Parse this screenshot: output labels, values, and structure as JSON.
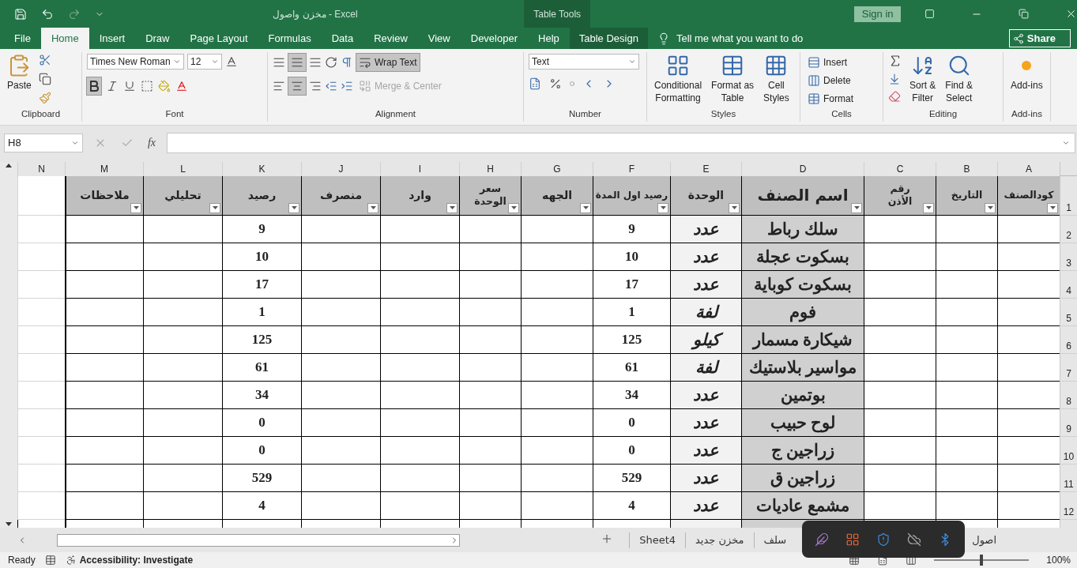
{
  "title_bar": {
    "title": "مخزن واصول  -  Excel",
    "context_group": "Table Tools",
    "sign_in": "Sign in"
  },
  "menu_tabs": {
    "file": {
      "label": "File",
      "selected": false,
      "kind": "file"
    },
    "home": {
      "label": "Home",
      "selected": true,
      "kind": "tab"
    },
    "insert": {
      "label": "Insert",
      "selected": false,
      "kind": "tab"
    },
    "draw": {
      "label": "Draw",
      "selected": false,
      "kind": "tab"
    },
    "page_layout": {
      "label": "Page Layout",
      "selected": false,
      "kind": "tab"
    },
    "formulas": {
      "label": "Formulas",
      "selected": false,
      "kind": "tab"
    },
    "data": {
      "label": "Data",
      "selected": false,
      "kind": "tab"
    },
    "review": {
      "label": "Review",
      "selected": false,
      "kind": "tab"
    },
    "view": {
      "label": "View",
      "selected": false,
      "kind": "tab"
    },
    "developer": {
      "label": "Developer",
      "selected": false,
      "kind": "tab"
    },
    "help": {
      "label": "Help",
      "selected": false,
      "kind": "tab"
    },
    "table_design": {
      "label": "Table Design",
      "selected": false,
      "kind": "context"
    }
  },
  "tell_me": {
    "placeholder": "Tell me what you want to do"
  },
  "share": "Share",
  "ribbon": {
    "clipboard": {
      "paste": "Paste",
      "label": "Clipboard"
    },
    "font": {
      "font_name": "Times New Roman",
      "font_size": "12",
      "bold_on": true,
      "label": "Font"
    },
    "alignment": {
      "middle_on": true,
      "center_on": true,
      "wrap_text": "Wrap Text",
      "wrap_on": true,
      "merge": "Merge & Center",
      "merge_disabled": true,
      "label": "Alignment"
    },
    "number": {
      "format": "Text",
      "label": "Number"
    },
    "styles": {
      "conditional_formatting": "Conditional\nFormatting",
      "format_as_table": "Format as\nTable",
      "cell_styles": "Cell\nStyles",
      "label": "Styles"
    },
    "cells": {
      "buttons": [
        "Insert",
        "Delete",
        "Format"
      ],
      "label": "Cells"
    },
    "editing": {
      "sort_filter": "Sort &\nFilter",
      "find_select": "Find &\nSelect",
      "label": "Editing"
    },
    "addins": {
      "button": "Add-ins",
      "label": "Add-ins"
    }
  },
  "formula_bar": {
    "name_box": "H8",
    "fx": "fx"
  },
  "sheet": {
    "columns": [
      "A",
      "B",
      "C",
      "D",
      "E",
      "F",
      "G",
      "H",
      "I",
      "J",
      "K",
      "L",
      "M",
      "N"
    ],
    "header_row": {
      "row": "1",
      "cells": [
        "كودالصنف",
        "التاريخ",
        "رقم\nالأذن",
        "اسم الصنف",
        "الوحدة",
        "رصيد اول المدة",
        "الجهه",
        "سعر\nالوحدة",
        "وارد",
        "منصرف",
        "رصيد",
        "تحليلي",
        "ملاحظات"
      ]
    },
    "rows": [
      {
        "row": "2",
        "item": "سلك رباط",
        "unit": "عدد",
        "opening": "9",
        "balance": "9"
      },
      {
        "row": "3",
        "item": "بسكوت عجلة",
        "unit": "عدد",
        "opening": "10",
        "balance": "10"
      },
      {
        "row": "4",
        "item": "بسكوت كوباية",
        "unit": "عدد",
        "opening": "17",
        "balance": "17"
      },
      {
        "row": "5",
        "item": "فوم",
        "unit": "لفة",
        "opening": "1",
        "balance": "1"
      },
      {
        "row": "6",
        "item": "شيكارة مسمار",
        "unit": "كيلو",
        "opening": "125",
        "balance": "125"
      },
      {
        "row": "7",
        "item": "مواسير بلاستيك",
        "unit": "لفة",
        "opening": "61",
        "balance": "61"
      },
      {
        "row": "8",
        "item": "بوتمين",
        "unit": "عدد",
        "opening": "34",
        "balance": "34"
      },
      {
        "row": "9",
        "item": "لوح حبيب",
        "unit": "عدد",
        "opening": "0",
        "balance": "0"
      },
      {
        "row": "10",
        "item": "زراجين ج",
        "unit": "عدد",
        "opening": "0",
        "balance": "0"
      },
      {
        "row": "11",
        "item": "زراجين ق",
        "unit": "عدد",
        "opening": "529",
        "balance": "529"
      },
      {
        "row": "12",
        "item": "مشمع عاديات",
        "unit": "عدد",
        "opening": "4",
        "balance": "4"
      }
    ]
  },
  "sheet_tabs": [
    {
      "label": "اصول"
    },
    {
      "label": "سلف"
    },
    {
      "label": "مخزن جديد"
    },
    {
      "label": "Sheet4"
    }
  ],
  "status_bar": {
    "ready": "Ready",
    "accessibility": "Accessibility: Investigate",
    "zoom": "100%",
    "zoom_slider": {
      "level": 0.5
    }
  }
}
